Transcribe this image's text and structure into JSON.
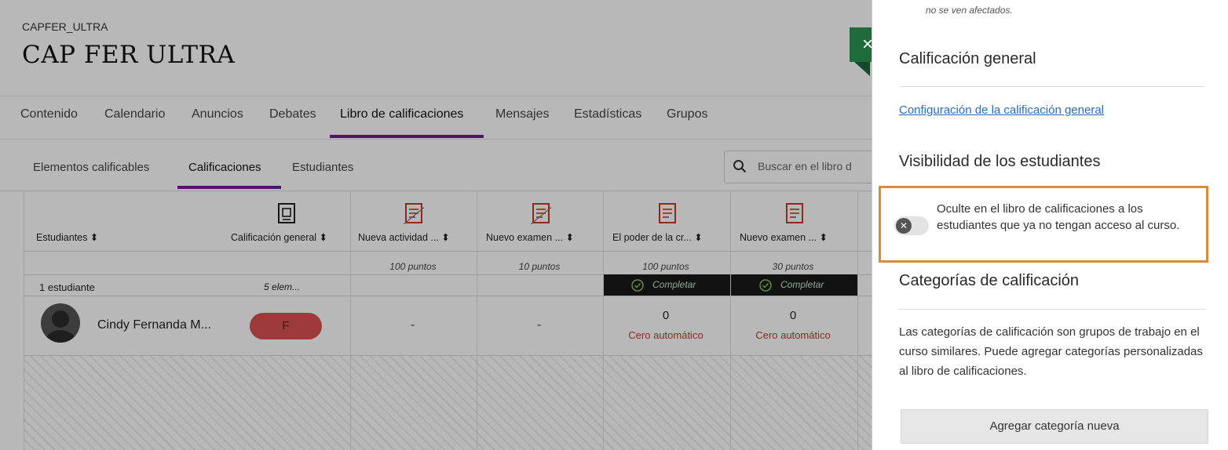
{
  "course": {
    "code": "CAPFER_ULTRA",
    "title": "CAP FER ULTRA"
  },
  "nav_tabs": [
    "Contenido",
    "Calendario",
    "Anuncios",
    "Debates",
    "Libro de calificaciones",
    "Mensajes",
    "Estadísticas",
    "Grupos"
  ],
  "active_tab": "Libro de calificaciones",
  "sub_tabs": [
    "Elementos calificables",
    "Calificaciones",
    "Estudiantes"
  ],
  "active_sub_tab": "Calificaciones",
  "search": {
    "placeholder": "Buscar en el libro d"
  },
  "gradebook": {
    "students_header": "Estudiantes ⬍",
    "columns": [
      {
        "title": "Calificación general ⬍",
        "points": "",
        "status": "",
        "icon": "overall-grade-icon"
      },
      {
        "title": "Nueva actividad ... ⬍",
        "points": "100 puntos",
        "status": "",
        "icon": "hidden-assignment-icon"
      },
      {
        "title": "Nuevo examen ... ⬍",
        "points": "10 puntos",
        "status": "",
        "icon": "hidden-assignment-icon"
      },
      {
        "title": "El poder de la cr... ⬍",
        "points": "100 puntos",
        "status": "Completar",
        "icon": "assignment-icon"
      },
      {
        "title": "Nuevo examen ... ⬍",
        "points": "30 puntos",
        "status": "Completar",
        "icon": "test-icon"
      }
    ],
    "student_count": "1 estudiante",
    "element_count": "5 elem...",
    "student": {
      "name": "Cindy Fernanda M...",
      "overall_grade": "F",
      "cells": [
        "-",
        "-",
        "0",
        "0"
      ],
      "auto_zero": "Cero automático"
    }
  },
  "panel": {
    "close_label": "×",
    "top_note": "no se ven afectados.",
    "overall_heading": "Calificación general",
    "overall_link": "Configuración de la calificación general",
    "visibility_heading": "Visibilidad de los estudiantes",
    "toggle_text": "Oculte en el libro de calificaciones a los estudiantes que ya no tengan acceso al curso.",
    "categories_heading": "Categorías de calificación",
    "categories_body": "Las categorías de calificación son grupos de trabajo en el curso similares. Puede agregar categorías personalizadas al libro de calificaciones.",
    "add_button": "Agregar categoría nueva"
  },
  "colors": {
    "accent_purple": "#6c1f8f",
    "close_green": "#1f6b3b",
    "highlight_orange": "#d98a3a",
    "grade_red": "#d9534f",
    "link_blue": "#2a6cc4"
  }
}
